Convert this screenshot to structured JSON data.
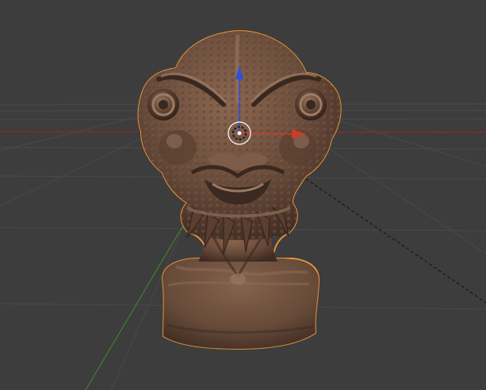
{
  "viewport": {
    "background_color": "#3d3d3d",
    "grid_color": "#4a4a4a",
    "x_axis_color": "#8e2b2b",
    "y_axis_color": "#3f7f2f",
    "outline_color": "#e6923a",
    "object_color": "#6a4c3b"
  },
  "scene_object": {
    "icon": "sculpted-bust-mesh",
    "selected": true
  },
  "gizmo": {
    "icon": "translate-gizmo-icon",
    "x_handle_color": "#d03a2a",
    "z_handle_color": "#2f4fd6",
    "pivot_icon": "pivot-point-icon"
  }
}
